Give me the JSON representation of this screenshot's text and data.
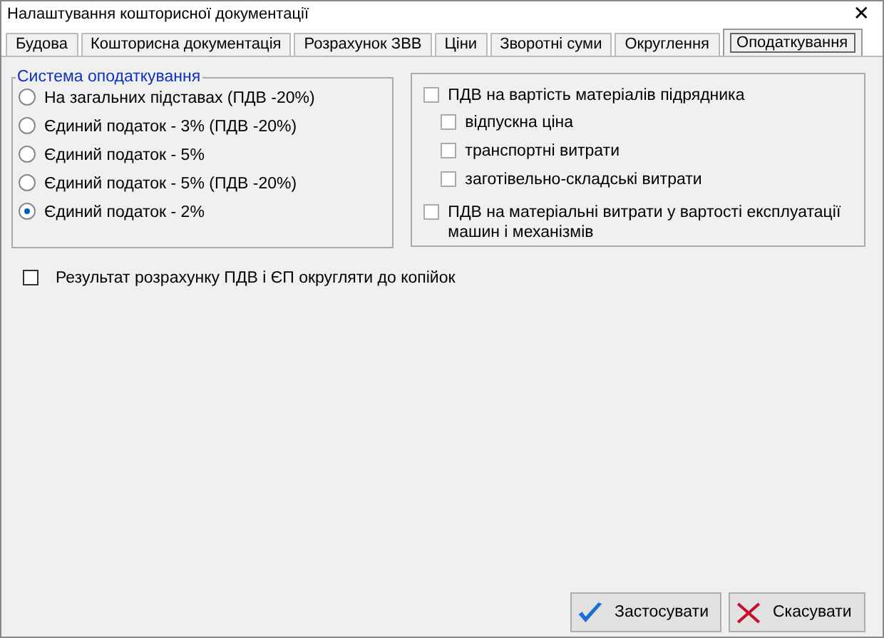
{
  "window": {
    "title": "Налаштування кошторисної документації",
    "close": "✕"
  },
  "tabs": [
    {
      "label": "Будова",
      "selected": false
    },
    {
      "label": "Кошторисна документація",
      "selected": false
    },
    {
      "label": "Розрахунок ЗВВ",
      "selected": false
    },
    {
      "label": "Ціни",
      "selected": false
    },
    {
      "label": "Зворотні суми",
      "selected": false
    },
    {
      "label": "Округлення",
      "selected": false
    },
    {
      "label": "Оподаткування",
      "selected": true
    }
  ],
  "tax_system": {
    "title": "Система оподаткування",
    "options": [
      {
        "label": "На загальних підставах (ПДВ -20%)",
        "selected": false
      },
      {
        "label": "Єдиний податок - 3% (ПДВ -20%)",
        "selected": false
      },
      {
        "label": "Єдиний податок - 5%",
        "selected": false
      },
      {
        "label": "Єдиний податок - 5% (ПДВ -20%)",
        "selected": false
      },
      {
        "label": "Єдиний податок - 2%",
        "selected": true
      }
    ]
  },
  "vat_options": [
    {
      "label": "ПДВ на вартість матеріалів підрядника",
      "checked": false,
      "children": [
        {
          "label": "відпускна ціна",
          "checked": false
        },
        {
          "label": "транспортні витрати",
          "checked": false
        },
        {
          "label": "заготівельно-складські витрати",
          "checked": false
        }
      ]
    },
    {
      "label": "ПДВ на матеріальні витрати у вартості експлуатації машин і механізмів",
      "checked": false
    }
  ],
  "round_option": {
    "label": "Результат розрахунку ПДВ і ЄП округляти до копійок",
    "checked": false
  },
  "buttons": [
    {
      "label": "Застосувати",
      "kind": "apply"
    },
    {
      "label": "Скасувати",
      "kind": "cancel"
    }
  ]
}
